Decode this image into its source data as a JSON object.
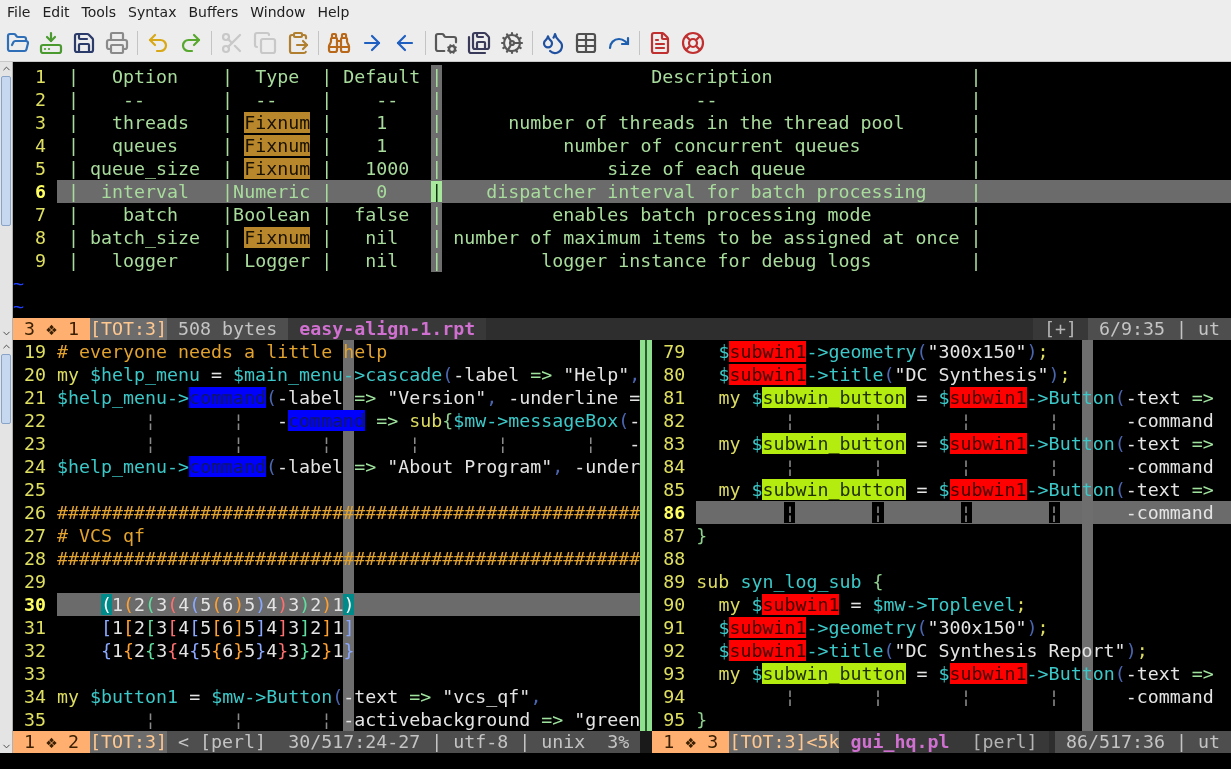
{
  "menu": [
    "File",
    "Edit",
    "Tools",
    "Syntax",
    "Buffers",
    "Window",
    "Help"
  ],
  "toolbar": {
    "groups": [
      [
        {
          "disabled": false
        },
        {
          "disabled": false
        },
        {
          "disabled": false
        },
        {
          "disabled": false
        }
      ],
      [
        {
          "disabled": false
        },
        {
          "disabled": false
        }
      ],
      [
        {
          "disabled": true
        },
        {
          "disabled": true
        },
        {
          "disabled": false
        }
      ],
      [
        {
          "disabled": false
        },
        {
          "disabled": false
        },
        {
          "disabled": false
        }
      ],
      [
        {
          "disabled": false
        },
        {
          "disabled": false
        },
        {
          "disabled": false
        }
      ],
      [
        {
          "disabled": false
        },
        {
          "disabled": false
        },
        {
          "disabled": false
        }
      ],
      [
        {
          "disabled": false
        },
        {
          "disabled": false
        }
      ]
    ]
  },
  "top_pane": {
    "lines": [
      {
        "n": "1",
        "current": false,
        "segs": [
          {
            "text": " |   Option    |  Type  | Default |                   Description                  |",
            "kind": "t"
          }
        ]
      },
      {
        "n": "2",
        "current": false,
        "segs": [
          {
            "text": " |    --       |  --    |    --   |                       --                       |",
            "kind": "t"
          }
        ]
      },
      {
        "n": "3",
        "current": false,
        "segs": [
          {
            "text": " |   threads   |",
            "kind": "t"
          },
          {
            "text": " Fixnum",
            "kind": "fix"
          },
          {
            "text": " |    1    |      number of threads in the thread pool      |",
            "kind": "t"
          }
        ]
      },
      {
        "n": "4",
        "current": false,
        "segs": [
          {
            "text": " |   queues    |",
            "kind": "t"
          },
          {
            "text": " Fixnum",
            "kind": "fix"
          },
          {
            "text": " |    1    |           number of concurrent queues          |",
            "kind": "t"
          }
        ]
      },
      {
        "n": "5",
        "current": false,
        "segs": [
          {
            "text": " | queue_size  |",
            "kind": "t"
          },
          {
            "text": " Fixnum",
            "kind": "fix"
          },
          {
            "text": " |   1000  |               size of each queue               |",
            "kind": "t"
          }
        ]
      },
      {
        "n": "6",
        "current": true,
        "segs": [
          {
            "text": " |  interval   |Numeric |    0    ",
            "kind": "t"
          },
          {
            "text": "|",
            "kind": "cur"
          },
          {
            "text": "    dispatcher interval for batch processing    |",
            "kind": "t"
          }
        ]
      },
      {
        "n": "7",
        "current": false,
        "segs": [
          {
            "text": " |    batch    |Boolean |  false  |          enables batch processing mode         |",
            "kind": "t"
          }
        ]
      },
      {
        "n": "8",
        "current": false,
        "segs": [
          {
            "text": " | batch_size  |",
            "kind": "t"
          },
          {
            "text": " Fixnum",
            "kind": "fix"
          },
          {
            "text": " |   nil   | number of maximum items to be assigned at once |",
            "kind": "t"
          }
        ]
      },
      {
        "n": "9",
        "current": false,
        "segs": [
          {
            "text": " |   logger    | Logger |   nil   |         logger instance for debug logs         |",
            "kind": "t"
          }
        ]
      }
    ],
    "filler": [
      "~",
      "~"
    ],
    "status": {
      "left": [
        {
          "text": "3 ❖ 1",
          "kind": "mode"
        },
        {
          "text": "[TOT:3]",
          "kind": "tot"
        },
        {
          "text": "508 bytes",
          "kind": "info"
        },
        {
          "text": "easy-align-1.rpt",
          "kind": "file"
        }
      ],
      "right": [
        {
          "text": "[+]",
          "kind": "flag"
        },
        {
          "text": "6/9:35 | ut",
          "kind": "pos"
        }
      ]
    }
  },
  "left_pane": {
    "lines": [
      {
        "n": "19",
        "current": false,
        "segs": [
          {
            "text": "# everyone needs a little help",
            "kind": "cm"
          }
        ]
      },
      {
        "n": "20",
        "current": false,
        "segs": [
          {
            "text": "my",
            "kind": "kw"
          },
          {
            "text": " $help_menu",
            "kind": "var"
          },
          {
            "text": " = ",
            "kind": "x"
          },
          {
            "text": "$main_menu->cascade",
            "kind": "var"
          },
          {
            "text": "(",
            "kind": "par"
          },
          {
            "text": "-label ",
            "kind": "x"
          },
          {
            "text": "=>",
            "kind": "arr"
          },
          {
            "text": " \"Help\"",
            "kind": "x"
          },
          {
            "text": ",",
            "kind": "par"
          }
        ]
      },
      {
        "n": "21",
        "current": false,
        "segs": [
          {
            "text": "$help_menu->",
            "kind": "var"
          },
          {
            "text": "command",
            "kind": "cmd"
          },
          {
            "text": "(",
            "kind": "par"
          },
          {
            "text": "-label ",
            "kind": "x"
          },
          {
            "text": "=>",
            "kind": "arr"
          },
          {
            "text": " \"Version\"",
            "kind": "x"
          },
          {
            "text": ",",
            "kind": "par"
          },
          {
            "text": " -underline =",
            "kind": "x"
          }
        ]
      },
      {
        "n": "22",
        "current": false,
        "segs": [
          {
            "text": "        ¦",
            "kind": "guide"
          },
          {
            "text": "       ¦",
            "kind": "guide"
          },
          {
            "text": "   -",
            "kind": "x"
          },
          {
            "text": "command",
            "kind": "cmd"
          },
          {
            "text": " =>",
            "kind": "arr"
          },
          {
            "text": " sub",
            "kind": "kw"
          },
          {
            "text": "{",
            "kind": "brace"
          },
          {
            "text": "$mw->messageBox",
            "kind": "var"
          },
          {
            "text": "(",
            "kind": "par"
          },
          {
            "text": "-",
            "kind": "x"
          }
        ]
      },
      {
        "n": "23",
        "current": false,
        "segs": [
          {
            "text": "        ¦",
            "kind": "guide"
          },
          {
            "text": "       ¦",
            "kind": "guide"
          },
          {
            "text": "       ¦",
            "kind": "guide"
          },
          {
            "text": "       ¦",
            "kind": "guide"
          },
          {
            "text": "       ¦",
            "kind": "guide"
          },
          {
            "text": "       ¦",
            "kind": "guide"
          },
          {
            "text": "   -",
            "kind": "x"
          }
        ]
      },
      {
        "n": "24",
        "current": false,
        "segs": [
          {
            "text": "$help_menu->",
            "kind": "var"
          },
          {
            "text": "command",
            "kind": "cmd"
          },
          {
            "text": "(",
            "kind": "par"
          },
          {
            "text": "-label ",
            "kind": "x"
          },
          {
            "text": "=>",
            "kind": "arr"
          },
          {
            "text": " \"About Program\"",
            "kind": "x"
          },
          {
            "text": ",",
            "kind": "par"
          },
          {
            "text": " -under",
            "kind": "x"
          }
        ]
      },
      {
        "n": "25",
        "current": false
      },
      {
        "n": "26",
        "current": false,
        "segs": [
          {
            "text": "#####################################################",
            "kind": "cm"
          }
        ]
      },
      {
        "n": "27",
        "current": false,
        "segs": [
          {
            "text": "# VCS qf",
            "kind": "cm"
          }
        ]
      },
      {
        "n": "28",
        "current": false,
        "segs": [
          {
            "text": "#####################################################",
            "kind": "cm"
          }
        ]
      },
      {
        "n": "29",
        "current": false
      },
      {
        "n": "30",
        "current": true,
        "segs": [
          {
            "text": "    (",
            "kind": "mt"
          },
          {
            "text": "1",
            "kind": "x"
          },
          {
            "text": "(",
            "kind": "r2"
          },
          {
            "text": "2",
            "kind": "x"
          },
          {
            "text": "(",
            "kind": "r3"
          },
          {
            "text": "3",
            "kind": "x"
          },
          {
            "text": "(",
            "kind": "r4"
          },
          {
            "text": "4",
            "kind": "x"
          },
          {
            "text": "(",
            "kind": "r5"
          },
          {
            "text": "5",
            "kind": "x"
          },
          {
            "text": "(",
            "kind": "r2"
          },
          {
            "text": "6",
            "kind": "x"
          },
          {
            "text": ")",
            "kind": "r2"
          },
          {
            "text": "5",
            "kind": "x"
          },
          {
            "text": ")",
            "kind": "r5"
          },
          {
            "text": "4",
            "kind": "x"
          },
          {
            "text": ")",
            "kind": "r4"
          },
          {
            "text": "3",
            "kind": "x"
          },
          {
            "text": ")",
            "kind": "r3"
          },
          {
            "text": "2",
            "kind": "x"
          },
          {
            "text": ")",
            "kind": "r2"
          },
          {
            "text": "1",
            "kind": "x"
          },
          {
            "text": ")",
            "kind": "mt"
          }
        ]
      },
      {
        "n": "31",
        "current": false,
        "segs": [
          {
            "text": "    [",
            "kind": "r5"
          },
          {
            "text": "1",
            "kind": "x"
          },
          {
            "text": "[",
            "kind": "r2"
          },
          {
            "text": "2",
            "kind": "x"
          },
          {
            "text": "[",
            "kind": "r3"
          },
          {
            "text": "3",
            "kind": "x"
          },
          {
            "text": "[",
            "kind": "r4"
          },
          {
            "text": "4",
            "kind": "x"
          },
          {
            "text": "[",
            "kind": "r5"
          },
          {
            "text": "5",
            "kind": "x"
          },
          {
            "text": "[",
            "kind": "r2"
          },
          {
            "text": "6",
            "kind": "x"
          },
          {
            "text": "]",
            "kind": "r2"
          },
          {
            "text": "5",
            "kind": "x"
          },
          {
            "text": "]",
            "kind": "r5"
          },
          {
            "text": "4",
            "kind": "x"
          },
          {
            "text": "]",
            "kind": "r4"
          },
          {
            "text": "3",
            "kind": "x"
          },
          {
            "text": "]",
            "kind": "r3"
          },
          {
            "text": "2",
            "kind": "x"
          },
          {
            "text": "]",
            "kind": "r2"
          },
          {
            "text": "1",
            "kind": "x"
          },
          {
            "text": "]",
            "kind": "r5"
          }
        ]
      },
      {
        "n": "32",
        "current": false,
        "segs": [
          {
            "text": "    {",
            "kind": "r5"
          },
          {
            "text": "1",
            "kind": "x"
          },
          {
            "text": "{",
            "kind": "r2"
          },
          {
            "text": "2",
            "kind": "x"
          },
          {
            "text": "{",
            "kind": "r3"
          },
          {
            "text": "3",
            "kind": "x"
          },
          {
            "text": "{",
            "kind": "r4"
          },
          {
            "text": "4",
            "kind": "x"
          },
          {
            "text": "{",
            "kind": "r5"
          },
          {
            "text": "5",
            "kind": "x"
          },
          {
            "text": "{",
            "kind": "r2"
          },
          {
            "text": "6",
            "kind": "x"
          },
          {
            "text": "}",
            "kind": "r2"
          },
          {
            "text": "5",
            "kind": "x"
          },
          {
            "text": "}",
            "kind": "r5"
          },
          {
            "text": "4",
            "kind": "x"
          },
          {
            "text": "}",
            "kind": "r4"
          },
          {
            "text": "3",
            "kind": "x"
          },
          {
            "text": "}",
            "kind": "r3"
          },
          {
            "text": "2",
            "kind": "x"
          },
          {
            "text": "}",
            "kind": "r2"
          },
          {
            "text": "1",
            "kind": "x"
          },
          {
            "text": "}",
            "kind": "r5"
          }
        ]
      },
      {
        "n": "33",
        "current": false
      },
      {
        "n": "34",
        "current": false,
        "segs": [
          {
            "text": "my",
            "kind": "kw"
          },
          {
            "text": " $button1",
            "kind": "var"
          },
          {
            "text": " = ",
            "kind": "x"
          },
          {
            "text": "$mw->Button",
            "kind": "var"
          },
          {
            "text": "(",
            "kind": "par"
          },
          {
            "text": "-text ",
            "kind": "x"
          },
          {
            "text": "=>",
            "kind": "arr"
          },
          {
            "text": " \"vcs_qf\"",
            "kind": "x"
          },
          {
            "text": ",",
            "kind": "par"
          }
        ]
      },
      {
        "n": "35",
        "current": false,
        "segs": [
          {
            "text": "        ¦",
            "kind": "guide"
          },
          {
            "text": "       ¦",
            "kind": "guide"
          },
          {
            "text": "       ¦",
            "kind": "guide"
          },
          {
            "text": " -activebackground ",
            "kind": "x"
          },
          {
            "text": "=>",
            "kind": "arr"
          },
          {
            "text": " \"green",
            "kind": "x"
          }
        ]
      }
    ],
    "status": {
      "left": [
        {
          "text": "1 ❖ 2",
          "kind": "mode"
        },
        {
          "text": "[TOT:3]",
          "kind": "tot"
        },
        {
          "text": "< [perl]",
          "kind": "info"
        }
      ],
      "right": [
        {
          "text": "30/517:24-27 | utf-8 | unix",
          "kind": "pos"
        },
        {
          "text": "3%",
          "kind": "pos"
        }
      ]
    }
  },
  "right_pane": {
    "lines": [
      {
        "n": "79",
        "current": false,
        "segs": [
          {
            "text": "  $",
            "kind": "var"
          },
          {
            "text": "subwin1",
            "kind": "red"
          },
          {
            "text": "->geometry",
            "kind": "var"
          },
          {
            "text": "(",
            "kind": "par"
          },
          {
            "text": "\"300x150\"",
            "kind": "x"
          },
          {
            "text": ")",
            "kind": "par"
          },
          {
            "text": ";",
            "kind": "kw"
          }
        ]
      },
      {
        "n": "80",
        "current": false,
        "segs": [
          {
            "text": "  $",
            "kind": "var"
          },
          {
            "text": "subwin1",
            "kind": "red"
          },
          {
            "text": "->title",
            "kind": "var"
          },
          {
            "text": "(",
            "kind": "par"
          },
          {
            "text": "\"DC Synthesis\"",
            "kind": "x"
          },
          {
            "text": ")",
            "kind": "par"
          },
          {
            "text": ";",
            "kind": "kw"
          }
        ]
      },
      {
        "n": "81",
        "current": false,
        "segs": [
          {
            "text": "  my",
            "kind": "kw"
          },
          {
            "text": " $",
            "kind": "var"
          },
          {
            "text": "subwin_button",
            "kind": "lime"
          },
          {
            "text": " = ",
            "kind": "x"
          },
          {
            "text": "$",
            "kind": "var"
          },
          {
            "text": "subwin1",
            "kind": "red"
          },
          {
            "text": "->Button",
            "kind": "var"
          },
          {
            "text": "(",
            "kind": "par"
          },
          {
            "text": "-text ",
            "kind": "x"
          },
          {
            "text": "=>",
            "kind": "arr"
          }
        ]
      },
      {
        "n": "82",
        "current": false,
        "segs": [
          {
            "text": "        ¦",
            "kind": "guide"
          },
          {
            "text": "       ¦",
            "kind": "guide"
          },
          {
            "text": "       ¦",
            "kind": "guide"
          },
          {
            "text": "       ¦",
            "kind": "guide"
          },
          {
            "text": "      -command",
            "kind": "x"
          }
        ]
      },
      {
        "n": "83",
        "current": false,
        "segs": [
          {
            "text": "  my",
            "kind": "kw"
          },
          {
            "text": " $",
            "kind": "var"
          },
          {
            "text": "subwin_button",
            "kind": "lime"
          },
          {
            "text": " = ",
            "kind": "x"
          },
          {
            "text": "$",
            "kind": "var"
          },
          {
            "text": "subwin1",
            "kind": "red"
          },
          {
            "text": "->Button",
            "kind": "var"
          },
          {
            "text": "(",
            "kind": "par"
          },
          {
            "text": "-text ",
            "kind": "x"
          },
          {
            "text": "=>",
            "kind": "arr"
          }
        ]
      },
      {
        "n": "84",
        "current": false,
        "segs": [
          {
            "text": "        ¦",
            "kind": "guide"
          },
          {
            "text": "       ¦",
            "kind": "guide"
          },
          {
            "text": "       ¦",
            "kind": "guide"
          },
          {
            "text": "       ¦",
            "kind": "guide"
          },
          {
            "text": "      -command",
            "kind": "x"
          }
        ]
      },
      {
        "n": "85",
        "current": false,
        "segs": [
          {
            "text": "  my",
            "kind": "kw"
          },
          {
            "text": " $",
            "kind": "var"
          },
          {
            "text": "subwin_button",
            "kind": "lime"
          },
          {
            "text": " = ",
            "kind": "x"
          },
          {
            "text": "$",
            "kind": "var"
          },
          {
            "text": "subwin1",
            "kind": "red"
          },
          {
            "text": "->Button",
            "kind": "var"
          },
          {
            "text": "(",
            "kind": "par"
          },
          {
            "text": "-text ",
            "kind": "x"
          },
          {
            "text": "=>",
            "kind": "arr"
          }
        ]
      },
      {
        "n": "86",
        "current": true,
        "segs": [
          {
            "text": "        ¦",
            "kind": "guide"
          },
          {
            "text": "       ¦",
            "kind": "guide"
          },
          {
            "text": "       ¦",
            "kind": "guide"
          },
          {
            "text": "       ¦",
            "kind": "guide"
          },
          {
            "text": "      -command",
            "kind": "x"
          }
        ]
      },
      {
        "n": "87",
        "current": false,
        "segs": [
          {
            "text": "}",
            "kind": "brace"
          }
        ]
      },
      {
        "n": "88",
        "current": false
      },
      {
        "n": "89",
        "current": false,
        "segs": [
          {
            "text": "sub",
            "kind": "kw"
          },
          {
            "text": " syn_log_sub",
            "kind": "var"
          },
          {
            "text": " {",
            "kind": "brace"
          }
        ]
      },
      {
        "n": "90",
        "current": false,
        "segs": [
          {
            "text": "  my",
            "kind": "kw"
          },
          {
            "text": " $",
            "kind": "var"
          },
          {
            "text": "subwin1",
            "kind": "red"
          },
          {
            "text": " = ",
            "kind": "x"
          },
          {
            "text": "$mw->Toplevel",
            "kind": "var"
          },
          {
            "text": ";",
            "kind": "kw"
          }
        ]
      },
      {
        "n": "91",
        "current": false,
        "segs": [
          {
            "text": "  $",
            "kind": "var"
          },
          {
            "text": "subwin1",
            "kind": "red"
          },
          {
            "text": "->geometry",
            "kind": "var"
          },
          {
            "text": "(",
            "kind": "par"
          },
          {
            "text": "\"300x150\"",
            "kind": "x"
          },
          {
            "text": ")",
            "kind": "par"
          },
          {
            "text": ";",
            "kind": "kw"
          }
        ]
      },
      {
        "n": "92",
        "current": false,
        "segs": [
          {
            "text": "  $",
            "kind": "var"
          },
          {
            "text": "subwin1",
            "kind": "red"
          },
          {
            "text": "->title",
            "kind": "var"
          },
          {
            "text": "(",
            "kind": "par"
          },
          {
            "text": "\"DC Synthesis Report\"",
            "kind": "x"
          },
          {
            "text": ")",
            "kind": "par"
          },
          {
            "text": ";",
            "kind": "kw"
          }
        ]
      },
      {
        "n": "93",
        "current": false,
        "segs": [
          {
            "text": "  my",
            "kind": "kw"
          },
          {
            "text": " $",
            "kind": "var"
          },
          {
            "text": "subwin_button",
            "kind": "lime"
          },
          {
            "text": " = ",
            "kind": "x"
          },
          {
            "text": "$",
            "kind": "var"
          },
          {
            "text": "subwin1",
            "kind": "red"
          },
          {
            "text": "->Button",
            "kind": "var"
          },
          {
            "text": "(",
            "kind": "par"
          },
          {
            "text": "-text ",
            "kind": "x"
          },
          {
            "text": "=>",
            "kind": "arr"
          }
        ]
      },
      {
        "n": "94",
        "current": false,
        "segs": [
          {
            "text": "        ¦",
            "kind": "guide"
          },
          {
            "text": "       ¦",
            "kind": "guide"
          },
          {
            "text": "       ¦",
            "kind": "guide"
          },
          {
            "text": "       ¦",
            "kind": "guide"
          },
          {
            "text": "      -command",
            "kind": "x"
          }
        ]
      },
      {
        "n": "95",
        "current": false,
        "segs": [
          {
            "text": "}",
            "kind": "brace"
          }
        ]
      }
    ],
    "status": {
      "left": [
        {
          "text": "1 ❖ 3",
          "kind": "mode"
        },
        {
          "text": "[TOT:3]",
          "kind": "tot"
        },
        {
          "text": "<5k",
          "kind": "tot"
        },
        {
          "text": "gui_hq.pl",
          "kind": "file"
        },
        {
          "text": "[perl]",
          "kind": "flag"
        }
      ],
      "right": [
        {
          "text": "86/517:36 | ut",
          "kind": "pos"
        }
      ]
    }
  }
}
